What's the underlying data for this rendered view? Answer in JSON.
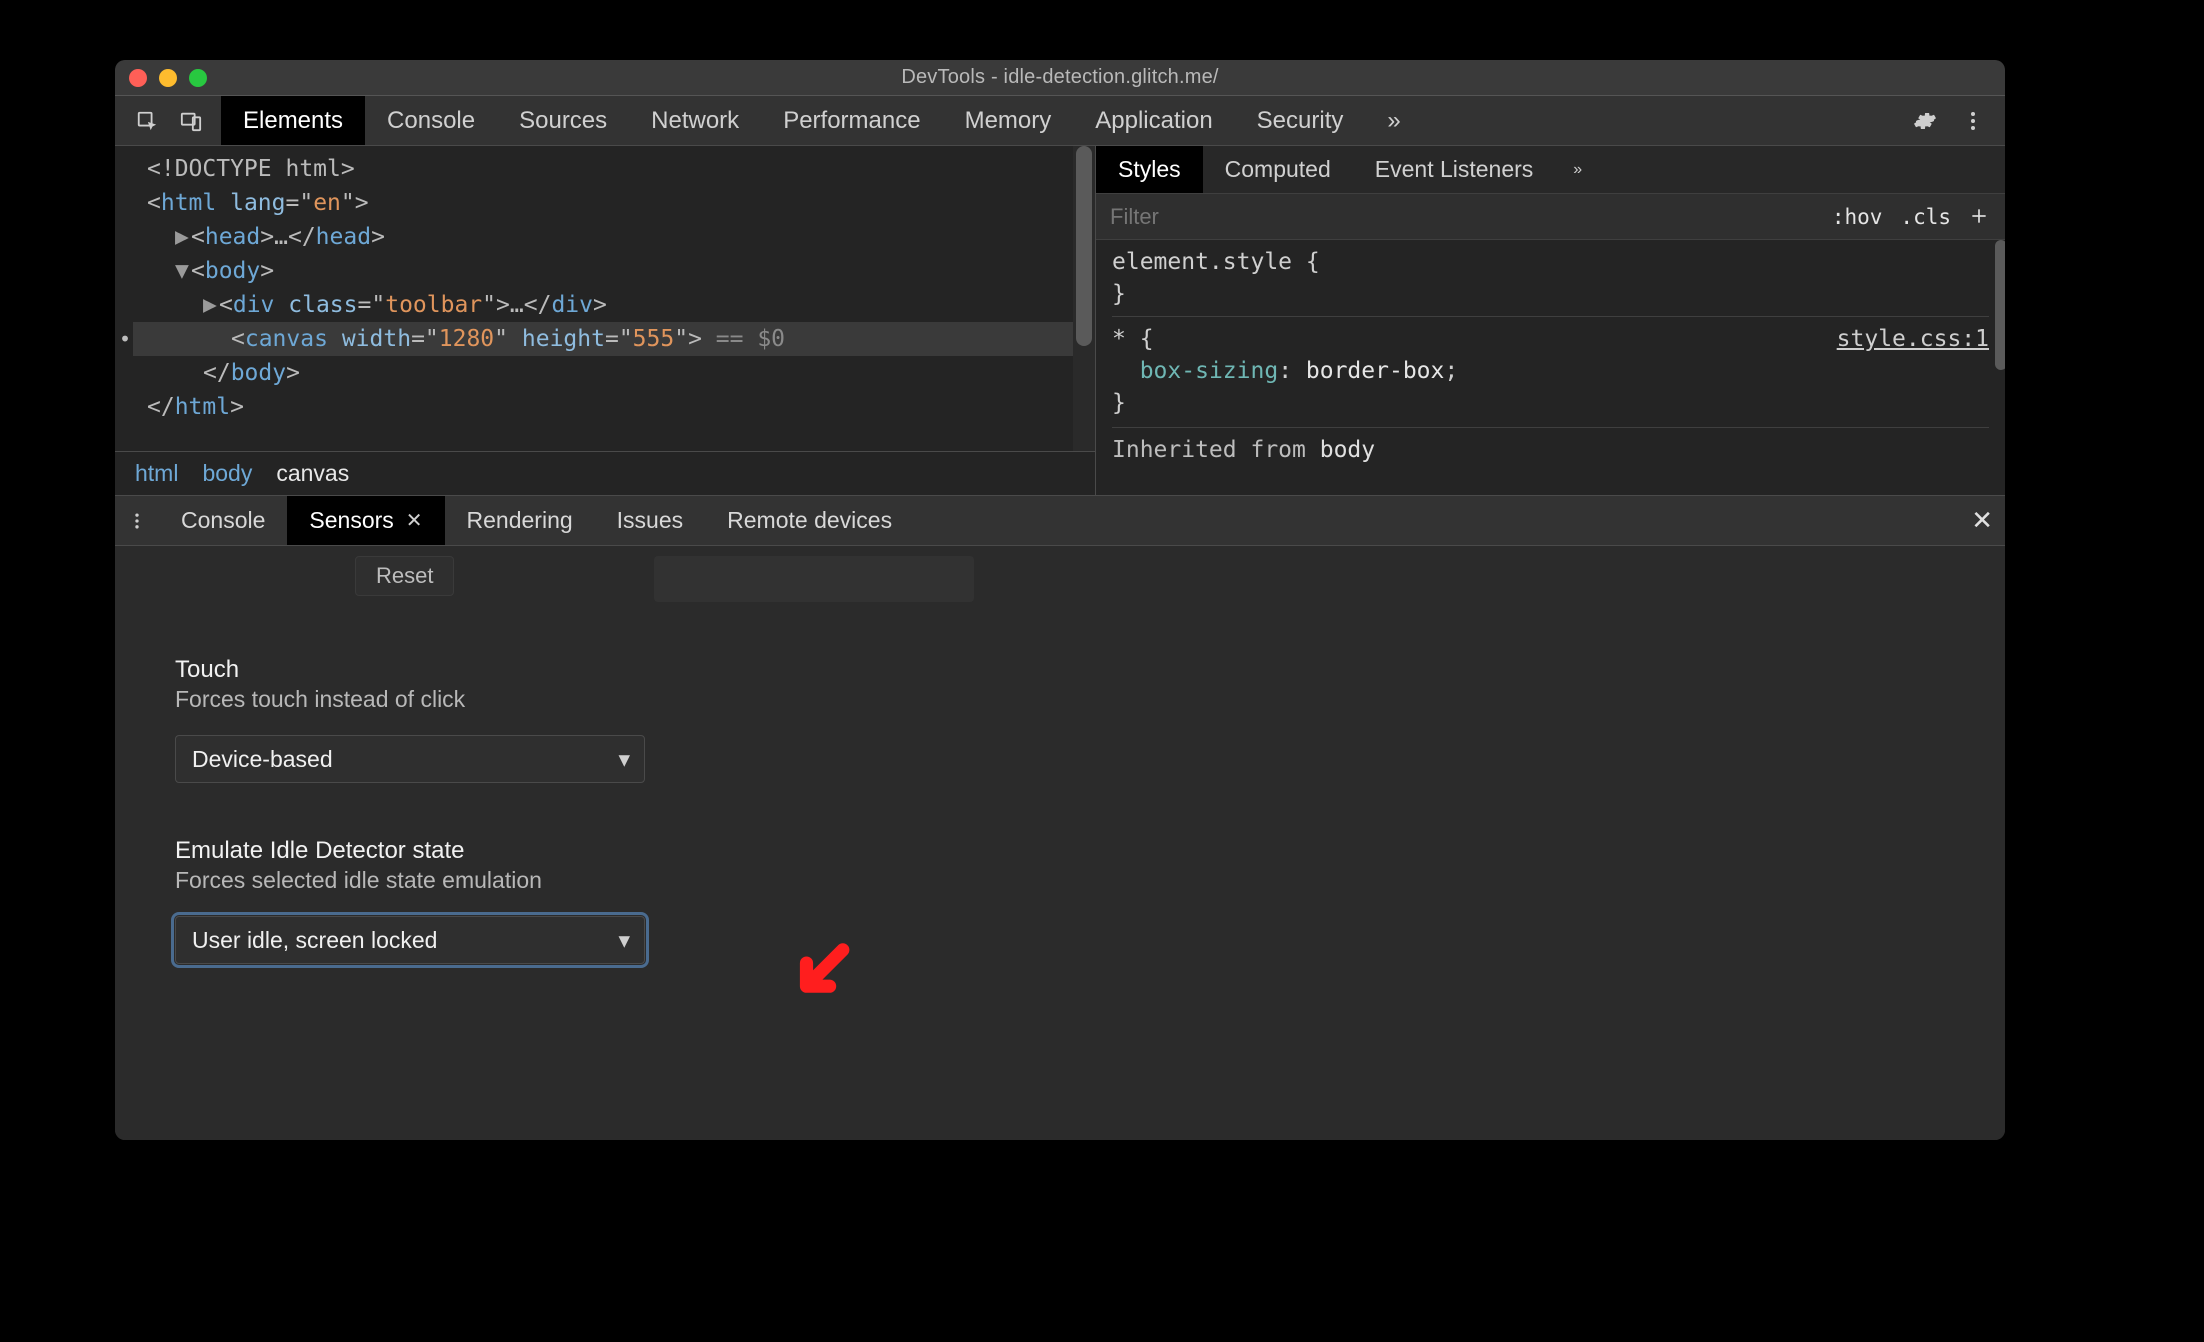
{
  "window": {
    "title": "DevTools - idle-detection.glitch.me/"
  },
  "toolbar": {
    "tabs": [
      "Elements",
      "Console",
      "Sources",
      "Network",
      "Performance",
      "Memory",
      "Application",
      "Security"
    ],
    "active": 0,
    "overflow_glyph": "»"
  },
  "dom": {
    "lines": [
      {
        "indent": 0,
        "caret": "",
        "html": "<!DOCTYPE html>",
        "kind": "doctype"
      },
      {
        "indent": 0,
        "caret": "",
        "open": "html",
        "attrs": [
          [
            "lang",
            "en"
          ]
        ]
      },
      {
        "indent": 1,
        "caret": "▶",
        "open": "head",
        "collapsed": true
      },
      {
        "indent": 1,
        "caret": "▼",
        "open": "body"
      },
      {
        "indent": 2,
        "caret": "▶",
        "open": "div",
        "attrs": [
          [
            "class",
            "toolbar"
          ]
        ],
        "collapsed": true
      },
      {
        "indent": 3,
        "selected": true,
        "open": "canvas",
        "attrs": [
          [
            "width",
            "1280"
          ],
          [
            "height",
            "555"
          ]
        ],
        "selhint": " == $0"
      },
      {
        "indent": 2,
        "close": "body"
      },
      {
        "indent": 0,
        "close": "html"
      }
    ],
    "selected_gutter": "•••",
    "breadcrumb": [
      "html",
      "body",
      "canvas"
    ],
    "breadcrumb_current": 2
  },
  "styles": {
    "tabs": [
      "Styles",
      "Computed",
      "Event Listeners"
    ],
    "active": 0,
    "overflow_glyph": "»",
    "filter_placeholder": "Filter",
    "toggles": {
      "hov": ":hov",
      "cls": ".cls"
    },
    "rules": [
      {
        "selector": "element.style",
        "decls": []
      },
      {
        "selector": "*",
        "source": "style.css:1",
        "decls": [
          [
            "box-sizing",
            "border-box"
          ]
        ]
      }
    ],
    "inherited_label": "Inherited from",
    "inherited_from": "body"
  },
  "drawer": {
    "tabs": [
      "Console",
      "Sensors",
      "Rendering",
      "Issues",
      "Remote devices"
    ],
    "active": 1,
    "closable": [
      1
    ],
    "reset_label": "Reset",
    "sections": {
      "touch": {
        "title": "Touch",
        "desc": "Forces touch instead of click",
        "value": "Device-based"
      },
      "idle": {
        "title": "Emulate Idle Detector state",
        "desc": "Forces selected idle state emulation",
        "value": "User idle, screen locked"
      }
    }
  }
}
